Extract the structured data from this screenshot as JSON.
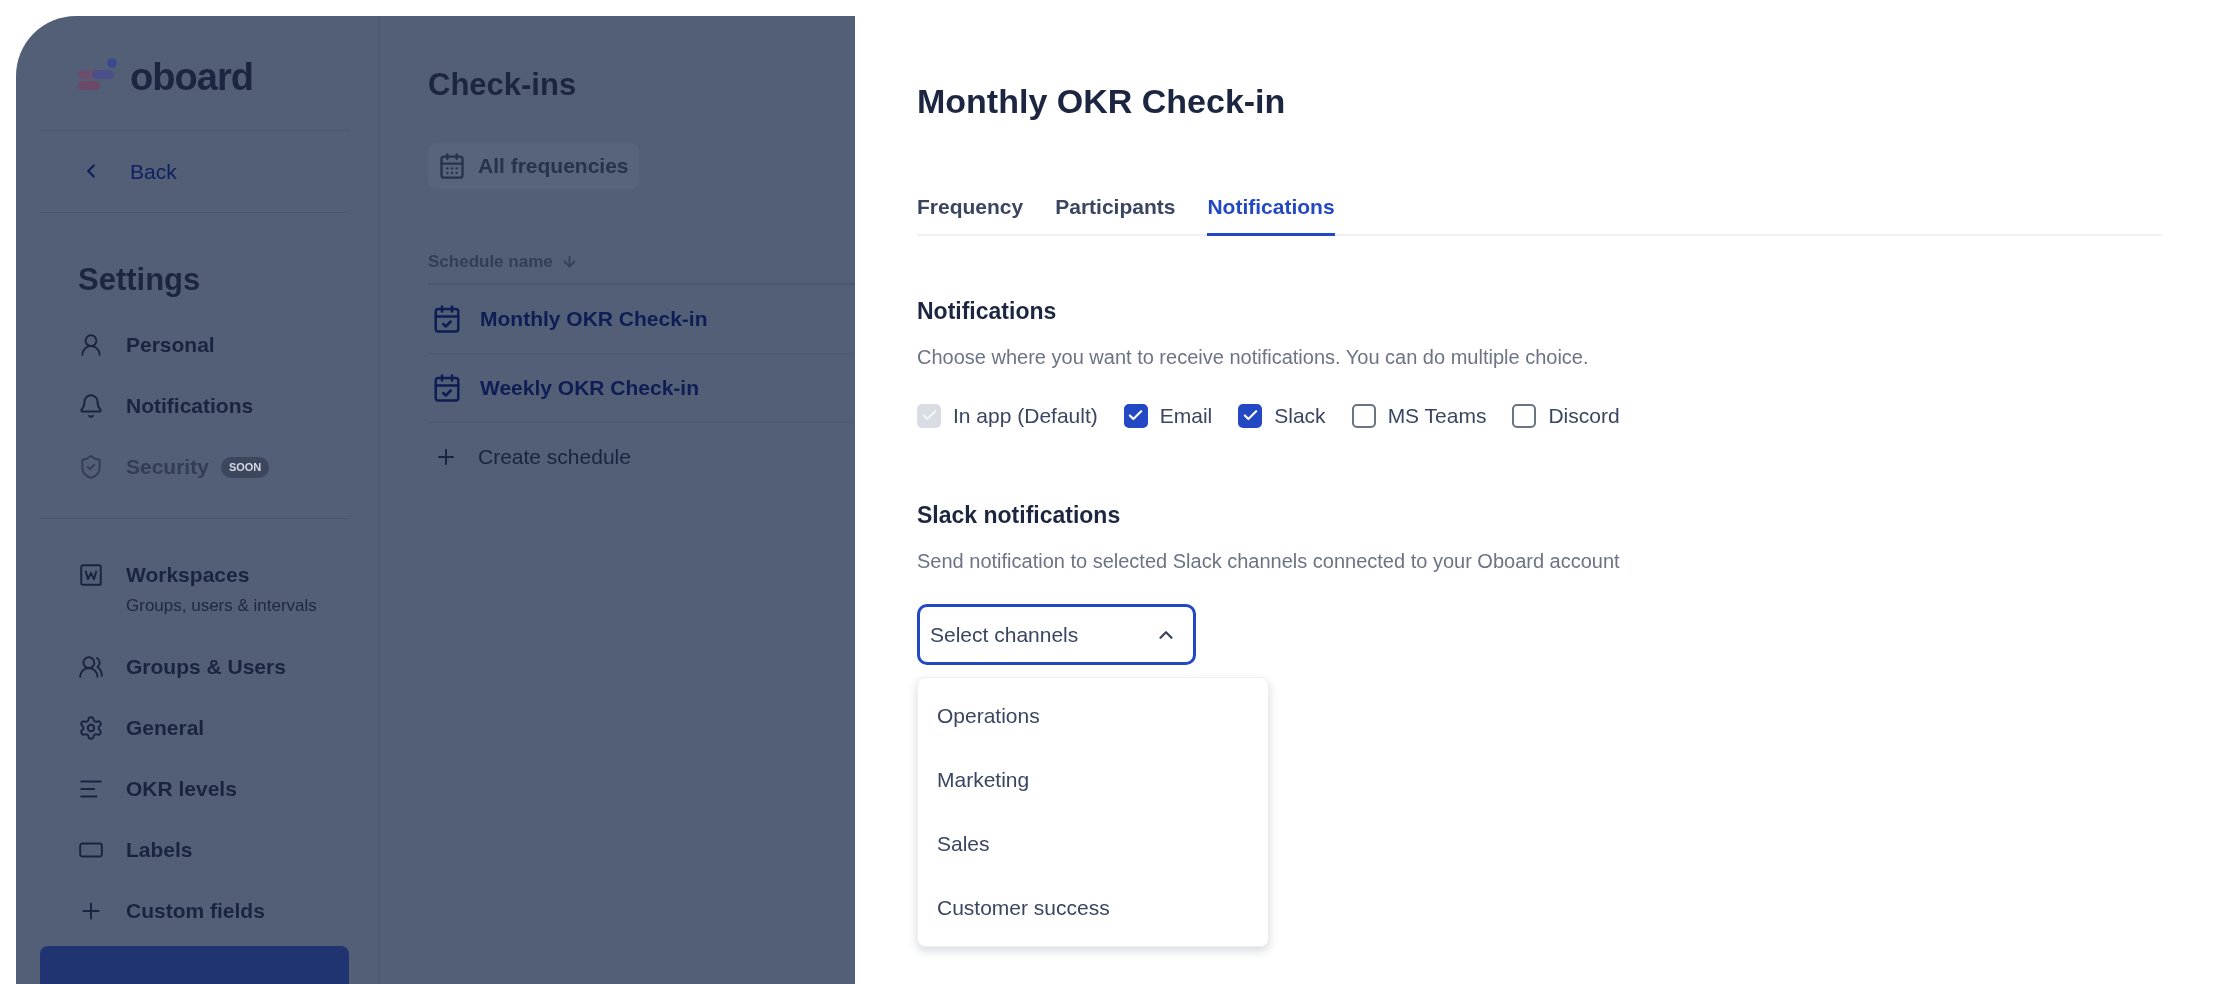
{
  "sidebar": {
    "logo": "oboard",
    "back": "Back",
    "title": "Settings",
    "groups": [
      [
        {
          "label": "Personal",
          "disabled": false
        },
        {
          "label": "Notifications",
          "disabled": false
        },
        {
          "label": "Security",
          "disabled": true,
          "badge": "SOON"
        }
      ],
      [
        {
          "label": "Workspaces",
          "disabled": false,
          "subtitle": "Groups, users & intervals"
        },
        {
          "label": "Groups & Users",
          "disabled": false
        },
        {
          "label": "General",
          "disabled": false
        },
        {
          "label": "OKR levels",
          "disabled": false
        },
        {
          "label": "Labels",
          "disabled": false
        },
        {
          "label": "Custom fields",
          "disabled": false
        }
      ]
    ],
    "has_selected_item_below": true
  },
  "checkins": {
    "title": "Check-ins",
    "filter": "All frequencies",
    "column": "Schedule name",
    "rows": [
      "Monthly OKR Check-in",
      "Weekly OKR Check-in"
    ],
    "create": "Create schedule"
  },
  "drawer": {
    "title": "Monthly OKR Check-in",
    "tabs": [
      {
        "label": "Frequency",
        "selected": false
      },
      {
        "label": "Participants",
        "selected": false
      },
      {
        "label": "Notifications",
        "selected": true
      }
    ],
    "notifications": {
      "heading": "Notifications",
      "description": "Choose where you want to receive notifications. You can do multiple choice.",
      "options": [
        {
          "label": "In app (Default)",
          "checked": true,
          "disabled": true
        },
        {
          "label": "Email",
          "checked": true,
          "disabled": false
        },
        {
          "label": "Slack",
          "checked": true,
          "disabled": false
        },
        {
          "label": "MS Teams",
          "checked": false,
          "disabled": false
        },
        {
          "label": "Discord",
          "checked": false,
          "disabled": false
        }
      ]
    },
    "slack": {
      "heading": "Slack notifications",
      "description": "Send notification to selected Slack channels connected to your Oboard account",
      "placeholder": "Select channels",
      "expanded": true,
      "channels": [
        "Operations",
        "Marketing",
        "Sales",
        "Customer success"
      ]
    }
  }
}
